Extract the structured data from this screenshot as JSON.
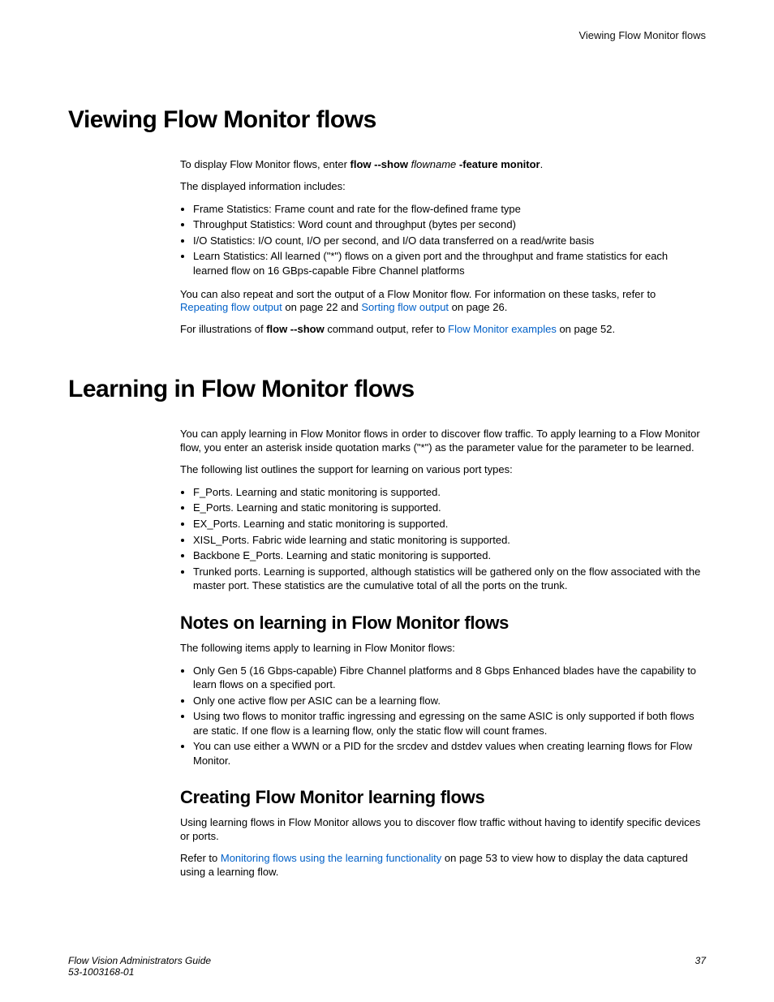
{
  "header": {
    "running": "Viewing Flow Monitor flows"
  },
  "s1": {
    "title": "Viewing Flow Monitor flows",
    "p1a": "To display Flow Monitor flows, enter ",
    "p1b": "flow --show",
    "p1c": " flowname ",
    "p1d": "-feature monitor",
    "p1e": ".",
    "p2": "The displayed information includes:",
    "bullets": [
      "Frame Statistics: Frame count and rate for the flow-defined frame type",
      "Throughput Statistics: Word count and throughput (bytes per second)",
      "I/O Statistics: I/O count, I/O per second, and I/O data transferred on a read/write basis",
      "Learn Statistics: All learned (\"*\") flows on a given port and the throughput and frame statistics for each learned flow on 16 GBps-capable Fibre Channel platforms"
    ],
    "p3a": "You can also repeat and sort the output of a Flow Monitor flow. For information on these tasks, refer to ",
    "link1": "Repeating flow output",
    "p3b": " on page 22 and ",
    "link2": "Sorting flow output",
    "p3c": " on page 26.",
    "p4a": "For illustrations of ",
    "p4b": "flow --show",
    "p4c": " command output, refer to ",
    "link3": "Flow Monitor examples",
    "p4d": " on page 52."
  },
  "s2": {
    "title": "Learning in Flow Monitor flows",
    "p1": "You can apply learning in Flow Monitor flows in order to discover flow traffic. To apply learning to a Flow Monitor flow, you enter an asterisk inside quotation marks (\"*\") as the parameter value for the parameter to be learned.",
    "p2": "The following list outlines the support for learning on various port types:",
    "bullets": [
      "F_Ports. Learning and static monitoring is supported.",
      "E_Ports. Learning and static monitoring is supported.",
      "EX_Ports. Learning and static monitoring is supported.",
      "XISL_Ports. Fabric wide learning and static monitoring is supported.",
      "Backbone E_Ports. Learning and static monitoring is supported.",
      "Trunked ports. Learning is supported, although statistics will be gathered only on the flow associated with the master port. These statistics are the cumulative total of all the ports on the trunk."
    ],
    "sub1": {
      "title": "Notes on learning in Flow Monitor flows",
      "p1": "The following items apply to learning in Flow Monitor flows:",
      "bullets": [
        "Only Gen 5 (16 Gbps-capable) Fibre Channel platforms and 8 Gbps Enhanced blades have the capability to learn flows on a specified port.",
        "Only one active flow per ASIC can be a learning flow.",
        "Using two flows to monitor traffic ingressing and egressing on the same ASIC is only supported if both flows are static. If one flow is a learning flow, only the static flow will count frames.",
        "You can use either a WWN or a PID for the srcdev and dstdev values when creating learning flows for Flow Monitor."
      ]
    },
    "sub2": {
      "title": "Creating Flow Monitor learning flows",
      "p1": "Using learning flows in Flow Monitor allows you to discover flow traffic without having to identify specific devices or ports.",
      "p2a": "Refer to ",
      "link": "Monitoring flows using the learning functionality",
      "p2b": " on page 53 to view how to display the data captured using a learning flow."
    }
  },
  "footer": {
    "title": "Flow Vision Administrators Guide",
    "docnum": "53-1003168-01",
    "page": "37"
  }
}
